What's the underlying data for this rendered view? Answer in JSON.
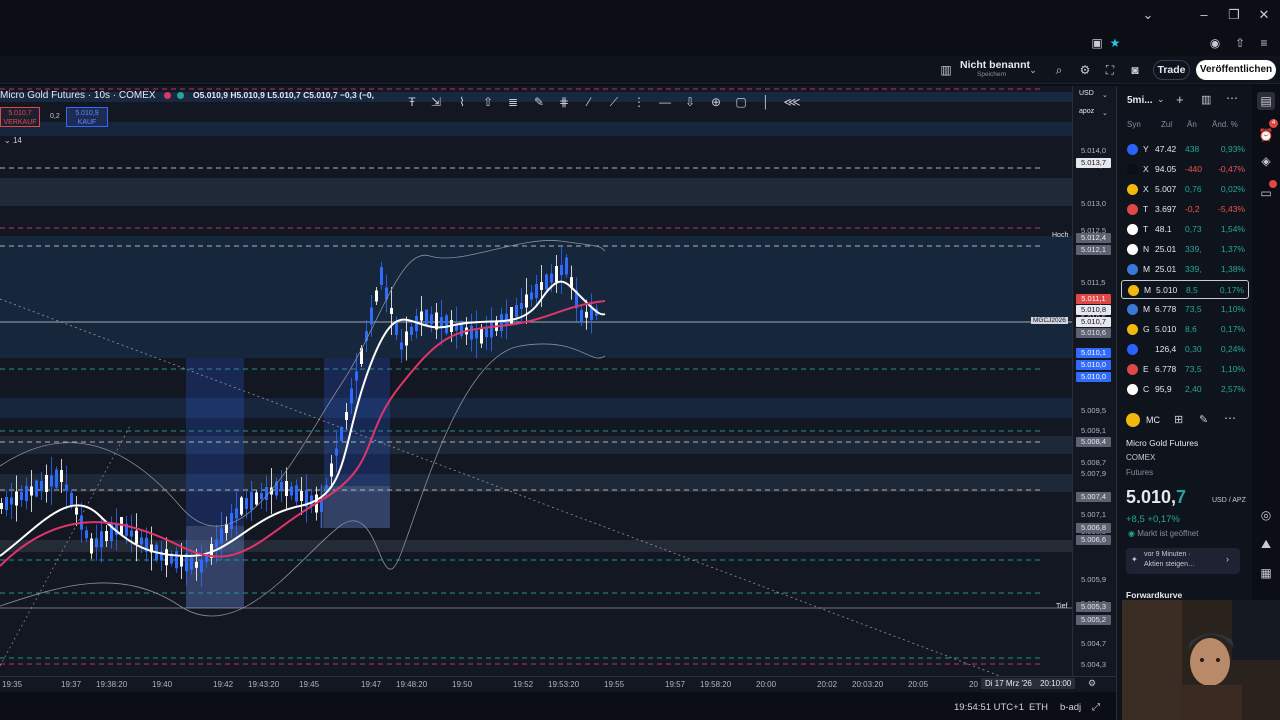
{
  "window": {
    "minimize_icon": "minimize-icon",
    "maximize_icon": "maximize-icon",
    "close_icon": "close-icon"
  },
  "toolbar": {
    "layout_name": "Nicht benannt",
    "layout_sub": "Speichern",
    "trade_label": "Trade",
    "publish_label": "Veröffentlichen"
  },
  "chart": {
    "symbol_line": "Micro Gold Futures · 10s · COMEX",
    "ohlc": "O5.010,9 H5.010,9 L5.010,7 C5.010,7 −0,3 (−0,",
    "sell_price": "5.010,7",
    "sell_label": "VERKAUF",
    "spread": "0,2",
    "buy_price": "5.010,9",
    "buy_label": "KAUF",
    "visible_count": "14",
    "high_label": "Hoch",
    "low_label": "Tief",
    "symbol_tag": "MGCJ2026",
    "colors": {
      "background": "#131722",
      "bull": "#2f6bff",
      "bear": "#ffffff",
      "fast_ma": "#ffffff",
      "slow_ma": "#e0356a",
      "resistance": "#e0356a",
      "support": "#26a69a"
    }
  },
  "price_axis": {
    "currency": "USD",
    "unit": "apoz",
    "labels": [
      "5.014,0",
      "5.013,5",
      "5.013,0",
      "5.012,5",
      "5.011,5",
      "5.011,0",
      "5.010,5",
      "5.009,5",
      "5.009,1",
      "5.008,7",
      "5.007,9",
      "5.007,1",
      "5.006,5",
      "5.005,9",
      "5.005,5",
      "5.004,7",
      "5.004,3"
    ],
    "tags": [
      {
        "text": "5.013,7",
        "kind": "white"
      },
      {
        "text": "5.012,4",
        "kind": "grey"
      },
      {
        "text": "5.012,1",
        "kind": "grey"
      },
      {
        "text": "5.011,1",
        "kind": "red"
      },
      {
        "text": "5.010,8",
        "kind": "white"
      },
      {
        "text": "5.010,7",
        "kind": "white"
      },
      {
        "text": "5.010,6",
        "kind": "grey"
      },
      {
        "text": "5.010,1",
        "kind": "blue"
      },
      {
        "text": "5.010,0",
        "kind": "blue"
      },
      {
        "text": "5.010,0",
        "kind": "blue"
      },
      {
        "text": "5.008,4",
        "kind": "grey"
      },
      {
        "text": "5.007,4",
        "kind": "grey"
      },
      {
        "text": "5.006,8",
        "kind": "grey"
      },
      {
        "text": "5.006,6",
        "kind": "grey"
      },
      {
        "text": "5.005,3",
        "kind": "grey"
      },
      {
        "text": "5.005,2",
        "kind": "grey"
      }
    ]
  },
  "time_axis": {
    "labels": [
      "19:35",
      "19:37",
      "19:38:20",
      "19:40",
      "19:42",
      "19:43:20",
      "19:45",
      "19:47",
      "19:48:20",
      "19:50",
      "19:52",
      "19:53:20",
      "19:55",
      "19:57",
      "19:58:20",
      "20:00",
      "20:02",
      "20:03:20",
      "20:05",
      "20"
    ],
    "cursor_date": "Di 17 Mrz '26",
    "cursor_time": "20:10:00"
  },
  "status": {
    "clock": "19:54:51 UTC+1",
    "session": "ETH",
    "adjust": "b-adj"
  },
  "watchlist": {
    "list_name": "5mi...",
    "columns": [
      "Syn",
      "Zul",
      "Än",
      "Änd. %"
    ],
    "rows": [
      {
        "icon_color": "#2962ff",
        "sym": "Y",
        "last": "47.42",
        "chg": "438",
        "pct": "0,93%",
        "dir": "up"
      },
      {
        "icon_color": "#0b0e14",
        "sym": "X",
        "last": "94.05",
        "chg": "-440",
        "pct": "-0,47%",
        "dir": "down"
      },
      {
        "icon_color": "#f0b90b",
        "sym": "X",
        "last": "5.007",
        "chg": "0,76",
        "pct": "0,02%",
        "dir": "up"
      },
      {
        "icon_color": "#e04848",
        "sym": "T",
        "last": "3.697",
        "chg": "-0,2",
        "pct": "-5,43%",
        "dir": "down"
      },
      {
        "icon_color": "#ffffff",
        "sym": "T",
        "last": "48.1",
        "chg": "0,73",
        "pct": "1,54%",
        "dir": "up"
      },
      {
        "icon_color": "#ffffff",
        "sym": "N",
        "last": "25.01",
        "chg": "339,",
        "pct": "1,37%",
        "dir": "up"
      },
      {
        "icon_color": "#3c78d8",
        "sym": "M",
        "last": "25.01",
        "chg": "339,",
        "pct": "1,38%",
        "dir": "up"
      },
      {
        "icon_color": "#f0b90b",
        "sym": "M",
        "last": "5.010",
        "chg": "8,5",
        "pct": "0,17%",
        "dir": "up"
      },
      {
        "icon_color": "#3c78d8",
        "sym": "M",
        "last": "6.778",
        "chg": "73,5",
        "pct": "1,10%",
        "dir": "up"
      },
      {
        "icon_color": "#f0b90b",
        "sym": "G",
        "last": "5.010",
        "chg": "8,6",
        "pct": "0,17%",
        "dir": "up"
      },
      {
        "icon_color": "#2962ff",
        "sym": "",
        "last": "126,4",
        "chg": "0,30",
        "pct": "0,24%",
        "dir": "up"
      },
      {
        "icon_color": "#e04848",
        "sym": "E",
        "last": "6.778",
        "chg": "73,5",
        "pct": "1,10%",
        "dir": "up"
      },
      {
        "icon_color": "#ffffff",
        "sym": "C",
        "last": "95,9",
        "chg": "2,40",
        "pct": "2,57%",
        "dir": "up"
      }
    ]
  },
  "details": {
    "ticker": "MC",
    "name": "Micro Gold Futures",
    "exchange": "COMEX",
    "type": "Futures",
    "price_main": "5.010,",
    "price_frac": "7",
    "unit": "USD / APZ",
    "change": "+8,5 +0,17%",
    "market_status": "Markt ist geöffnet",
    "news_a": "vor 9 Minuten ·",
    "news_b": "Aktien steigen…",
    "forward_label": "Forwardkurve"
  }
}
